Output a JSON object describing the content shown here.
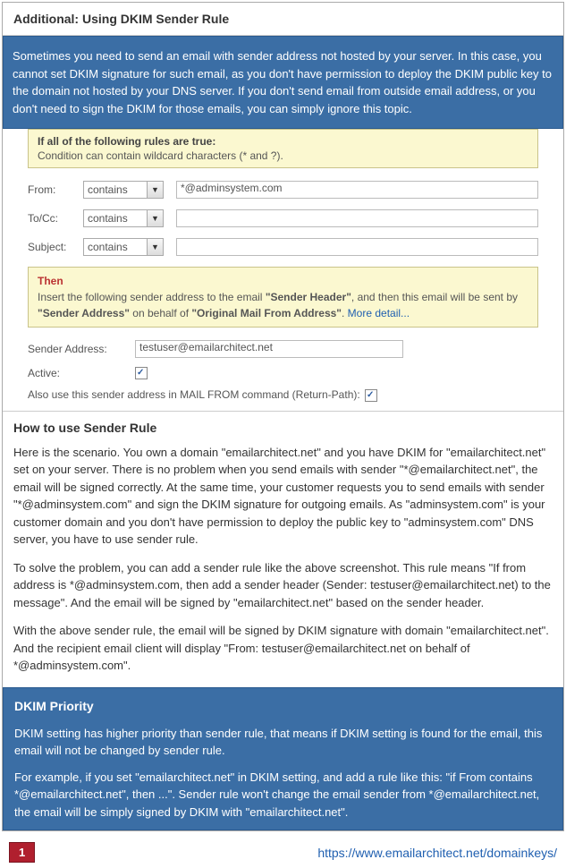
{
  "header": {
    "title": "Additional: Using DKIM Sender Rule"
  },
  "intro_box": "Sometimes you need to send an email with sender address not hosted by your server. In this case, you cannot set DKIM signature for such email, as you don't have permission to deploy the DKIM public key to the domain not hosted by your DNS server. If you don't send email from outside email address, or you don't need to sign the DKIM for those emails, you can simply ignore this topic.",
  "conditions": {
    "title": "If all of the following rules are true:",
    "subtitle": "Condition can contain wildcard characters (* and ?).",
    "rows": [
      {
        "label": "From:",
        "op": "contains",
        "value": "*@adminsystem.com"
      },
      {
        "label": "To/Cc:",
        "op": "contains",
        "value": ""
      },
      {
        "label": "Subject:",
        "op": "contains",
        "value": ""
      }
    ]
  },
  "then": {
    "title": "Then",
    "text_pre": "Insert the following sender address to the email ",
    "bold1": "\"Sender Header\"",
    "text_mid": ", and then this email will be sent by ",
    "bold2": "\"Sender Address\"",
    "text_mid2": " on behalf of ",
    "bold3": "\"Original Mail From Address\"",
    "text_post": ". ",
    "more_detail": "More detail..."
  },
  "sender": {
    "label": "Sender Address:",
    "value": "testuser@emailarchitect.net"
  },
  "active": {
    "label": "Active:"
  },
  "also": {
    "text": "Also use this sender address in MAIL FROM command (Return-Path):"
  },
  "howto": {
    "title": "How to use Sender Rule",
    "p1": "Here is the scenario. You own a domain \"emailarchitect.net\" and you have DKIM for \"emailarchitect.net\" set on your server. There is no problem when you send emails with sender \"*@emailarchitect.net\", the email will be signed correctly. At the same time, your customer requests you to send emails with sender \"*@adminsystem.com\" and sign the DKIM signature for outgoing emails. As \"adminsystem.com\" is your customer domain and you don't have permission to deploy the public key to \"adminsystem.com\" DNS server, you have to use sender rule.",
    "p2": "To solve the problem, you can add a sender rule like the above screenshot. This rule means \"If from address is *@adminsystem.com, then add a sender header (Sender: testuser@emailarchitect.net) to the message\". And the email will be signed by \"emailarchitect.net\" based on the sender header.",
    "p3": "With the above sender rule, the email will be signed by DKIM signature with domain \"emailarchitect.net\". And the recipient email client will display \"From: testuser@emailarchitect.net on behalf of *@adminsystem.com\"."
  },
  "priority": {
    "title": "DKIM Priority",
    "p1": "DKIM setting has higher priority than sender rule, that means if DKIM setting is found for the email, this email will not be changed by sender rule.",
    "p2": "For example, if you set \"emailarchitect.net\" in DKIM setting, and add a rule like this: \"if From contains *@emailarchitect.net\", then ...\". Sender rule won't change the email sender from *@emailarchitect.net, the email will be simply signed by DKIM with \"emailarchitect.net\"."
  },
  "footer": {
    "page": "1",
    "url": "https://www.emailarchitect.net/domainkeys/"
  }
}
